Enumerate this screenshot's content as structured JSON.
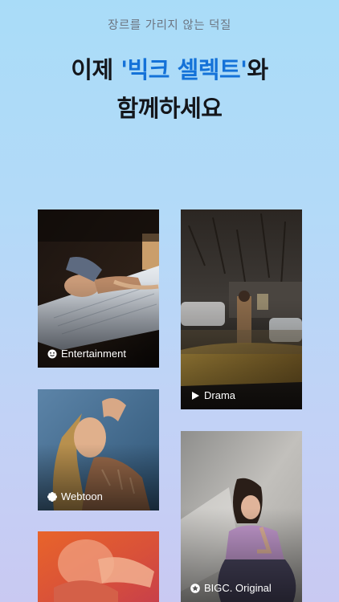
{
  "header": {
    "subtitle": "장르를 가리지 않는 덕질",
    "line1_prefix": "이제 ",
    "line1_highlight": "'빅크 셀렉트'",
    "line1_suffix": "와",
    "line2": "함께하세요",
    "highlight_color": "#1472d8"
  },
  "cards": [
    {
      "label": "Entertainment",
      "icon": "smiley-icon"
    },
    {
      "label": "Drama",
      "icon": "play-icon"
    },
    {
      "label": "Webtoon",
      "icon": "flower-icon"
    },
    {
      "label": "BIGC. Original",
      "icon": "star-icon"
    }
  ]
}
